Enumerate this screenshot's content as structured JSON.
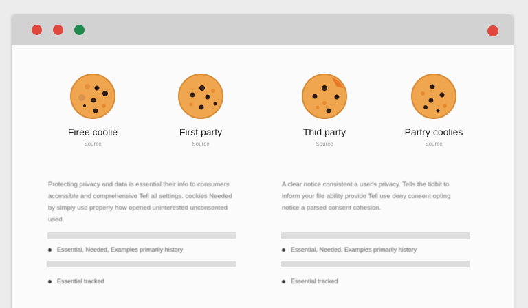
{
  "window": {
    "titlebar_buttons": [
      "close-dot",
      "minimize-dot",
      "maximize-dot",
      "window-close-dot"
    ]
  },
  "cookies": [
    {
      "title": "Firee coolie",
      "subtitle": "Source"
    },
    {
      "title": "First party",
      "subtitle": "Source"
    },
    {
      "title": "Thid party",
      "subtitle": "Source"
    },
    {
      "title": "Partry coolies",
      "subtitle": "Source"
    }
  ],
  "left_panel": {
    "paragraph": "Protecting privacy and data is essential their info to consumers accessible and comprehensive Tell all settings. cookies Needed by simply use properly how opened uninterested unconsented used.",
    "bullets": [
      "Essential, Needed, Examples primarily history",
      "Essential tracked"
    ]
  },
  "right_panel": {
    "paragraph": "A clear notice consistent a user's privacy. Tells the tidbit to inform your file ability provide Tell use deny consent opting notice a parsed consent cohesion.",
    "bullets": [
      "Essential, Needed, Examples primarily history",
      "Essential tracked"
    ]
  },
  "colors": {
    "titlebar": "#d2d2d2",
    "red": "#e0483e",
    "green": "#1f8a4c",
    "cookie": "#f0a64e",
    "chip": "#2a1a12"
  }
}
